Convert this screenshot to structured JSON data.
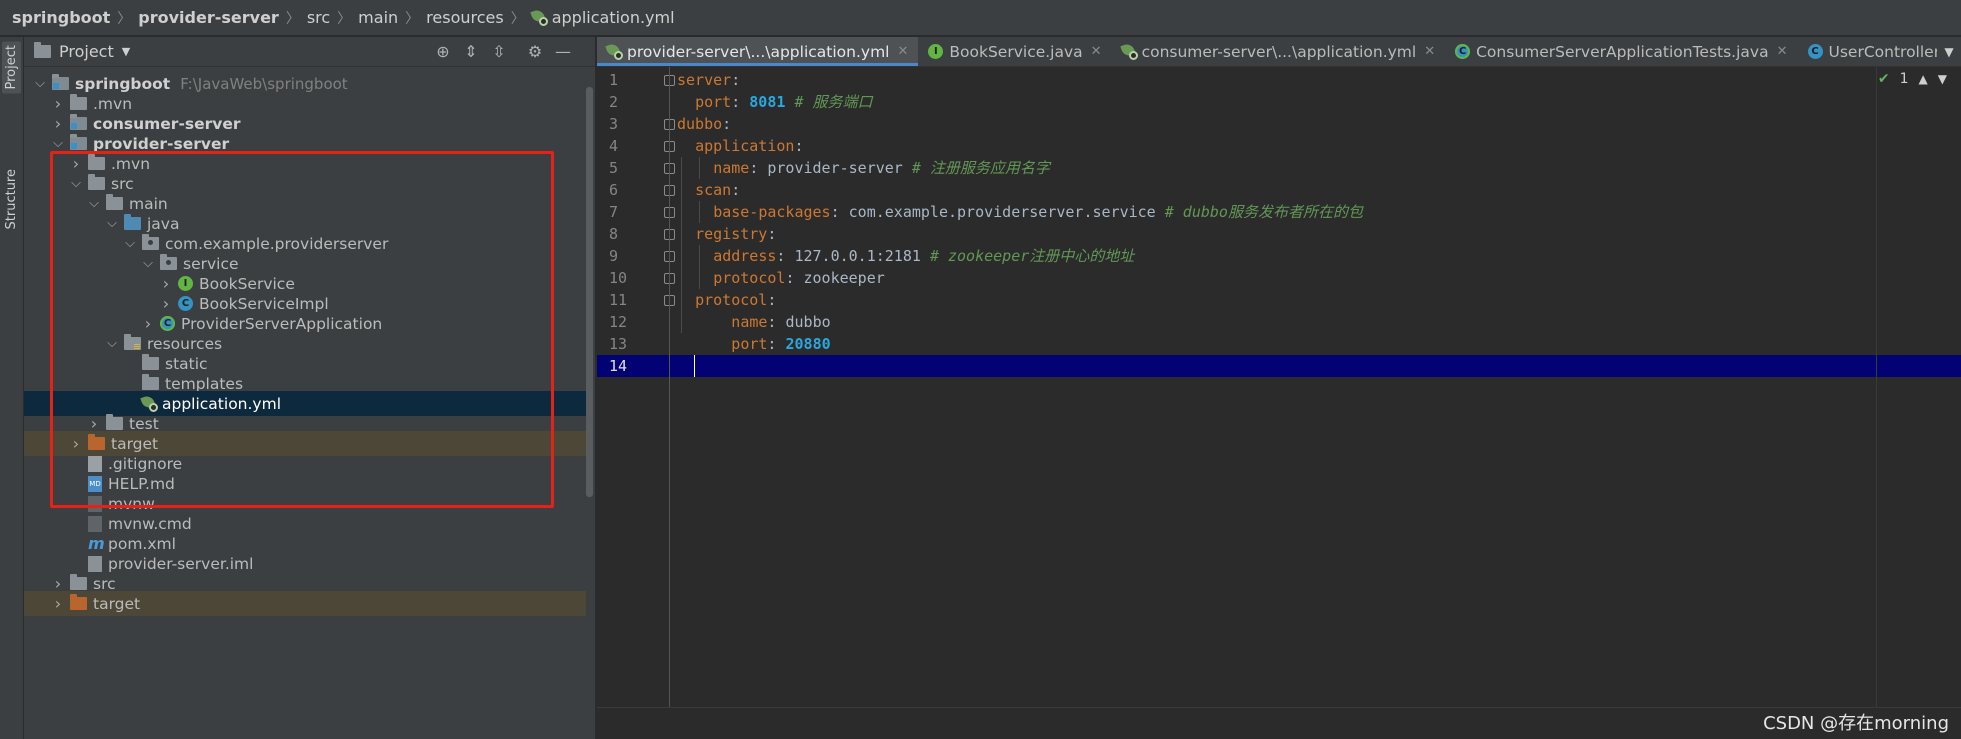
{
  "breadcrumb": {
    "items": [
      "springboot",
      "provider-server",
      "src",
      "main",
      "resources",
      "application.yml"
    ]
  },
  "left_strip": {
    "project_tab": "Project",
    "structure_tab": "Structure"
  },
  "project_panel": {
    "title": "Project",
    "tree": [
      {
        "label": "springboot",
        "path": "F:\\JavaWeb\\springboot",
        "depth": 0,
        "expanded": true,
        "icon": "module-folder-icon",
        "bold": true
      },
      {
        "label": ".mvn",
        "depth": 1,
        "expanded": false,
        "icon": "folder-icon"
      },
      {
        "label": "consumer-server",
        "depth": 1,
        "expanded": false,
        "icon": "module-folder-icon",
        "bold": true
      },
      {
        "label": "provider-server",
        "depth": 1,
        "expanded": true,
        "icon": "module-folder-icon",
        "bold": true
      },
      {
        "label": ".mvn",
        "depth": 2,
        "expanded": false,
        "icon": "folder-icon"
      },
      {
        "label": "src",
        "depth": 2,
        "expanded": true,
        "icon": "folder-icon"
      },
      {
        "label": "main",
        "depth": 3,
        "expanded": true,
        "icon": "folder-icon"
      },
      {
        "label": "java",
        "depth": 4,
        "expanded": true,
        "icon": "source-folder-icon"
      },
      {
        "label": "com.example.providerserver",
        "depth": 5,
        "expanded": true,
        "icon": "package-icon"
      },
      {
        "label": "service",
        "depth": 6,
        "expanded": true,
        "icon": "package-icon"
      },
      {
        "label": "BookService",
        "depth": 7,
        "expanded": false,
        "icon": "interface-icon"
      },
      {
        "label": "BookServiceImpl",
        "depth": 7,
        "expanded": false,
        "icon": "class-icon"
      },
      {
        "label": "ProviderServerApplication",
        "depth": 6,
        "expanded": false,
        "icon": "spring-boot-class-icon"
      },
      {
        "label": "resources",
        "depth": 4,
        "expanded": true,
        "icon": "resources-folder-icon"
      },
      {
        "label": "static",
        "depth": 5,
        "leaf": true,
        "icon": "folder-icon"
      },
      {
        "label": "templates",
        "depth": 5,
        "leaf": true,
        "icon": "folder-icon"
      },
      {
        "label": "application.yml",
        "depth": 5,
        "leaf": true,
        "icon": "yaml-file-icon",
        "selected": true
      },
      {
        "label": "test",
        "depth": 3,
        "expanded": false,
        "icon": "folder-icon"
      },
      {
        "label": "target",
        "depth": 2,
        "expanded": false,
        "icon": "excluded-folder-icon",
        "excluded": true
      },
      {
        "label": ".gitignore",
        "depth": 2,
        "leaf": true,
        "icon": "gitignore-file-icon"
      },
      {
        "label": "HELP.md",
        "depth": 2,
        "leaf": true,
        "icon": "markdown-file-icon"
      },
      {
        "label": "mvnw",
        "depth": 2,
        "leaf": true,
        "icon": "shell-file-icon"
      },
      {
        "label": "mvnw.cmd",
        "depth": 2,
        "leaf": true,
        "icon": "cmd-file-icon"
      },
      {
        "label": "pom.xml",
        "depth": 2,
        "leaf": true,
        "icon": "maven-pom-icon"
      },
      {
        "label": "provider-server.iml",
        "depth": 2,
        "leaf": true,
        "icon": "iml-file-icon"
      },
      {
        "label": "src",
        "depth": 1,
        "expanded": false,
        "icon": "folder-icon"
      },
      {
        "label": "target",
        "depth": 1,
        "expanded": false,
        "icon": "excluded-folder-icon",
        "excluded": true
      }
    ]
  },
  "tabs": [
    {
      "label": "provider-server\\...\\application.yml",
      "icon": "yaml-file-icon",
      "active": true,
      "closable": true
    },
    {
      "label": "BookService.java",
      "icon": "interface-icon",
      "closable": true
    },
    {
      "label": "consumer-server\\...\\application.yml",
      "icon": "yaml-file-icon",
      "closable": true
    },
    {
      "label": "ConsumerServerApplicationTests.java",
      "icon": "spring-boot-class-icon",
      "closable": true
    },
    {
      "label": "UserController.java",
      "icon": "class-icon",
      "closable": false
    }
  ],
  "inspection": {
    "count": "1"
  },
  "code": {
    "lines": [
      {
        "no": "1",
        "indent": 0,
        "key": "server",
        "value": "",
        "comment": ""
      },
      {
        "no": "2",
        "indent": 1,
        "key": "port",
        "value": "8081",
        "value_kind": "number",
        "comment": "# 服务端口"
      },
      {
        "no": "3",
        "indent": 0,
        "key": "dubbo",
        "value": "",
        "comment": ""
      },
      {
        "no": "4",
        "indent": 1,
        "key": "application",
        "value": "",
        "comment": ""
      },
      {
        "no": "5",
        "indent": 2,
        "key": "name",
        "value": "provider-server",
        "value_kind": "text",
        "comment": "# 注册服务应用名字"
      },
      {
        "no": "6",
        "indent": 1,
        "key": "scan",
        "value": "",
        "comment": ""
      },
      {
        "no": "7",
        "indent": 2,
        "key": "base-packages",
        "value": "com.example.providerserver.service",
        "value_kind": "text",
        "comment": "# dubbo服务发布者所在的包"
      },
      {
        "no": "8",
        "indent": 1,
        "key": "registry",
        "value": "",
        "comment": ""
      },
      {
        "no": "9",
        "indent": 2,
        "key": "address",
        "value": "127.0.0.1:2181",
        "value_kind": "text",
        "comment": "# zookeeper注册中心的地址"
      },
      {
        "no": "10",
        "indent": 2,
        "key": "protocol",
        "value": "zookeeper",
        "value_kind": "text",
        "comment": ""
      },
      {
        "no": "11",
        "indent": 1,
        "key": "protocol",
        "value": "",
        "comment": ""
      },
      {
        "no": "12",
        "indent": 3,
        "key": "name",
        "value": "dubbo",
        "value_kind": "text",
        "comment": ""
      },
      {
        "no": "13",
        "indent": 3,
        "key": "port",
        "value": "20880",
        "value_kind": "number",
        "comment": ""
      },
      {
        "no": "14",
        "indent": 0,
        "key": "",
        "value": "",
        "comment": "",
        "current": true
      }
    ]
  },
  "watermark": "CSDN @存在morning",
  "colors": {
    "keyword": "#cc7832",
    "number": "#29a8e0",
    "comment": "#629755",
    "current_line": "#020274",
    "selection_row": "#0d293e",
    "highlight_box": "#e2231a"
  }
}
